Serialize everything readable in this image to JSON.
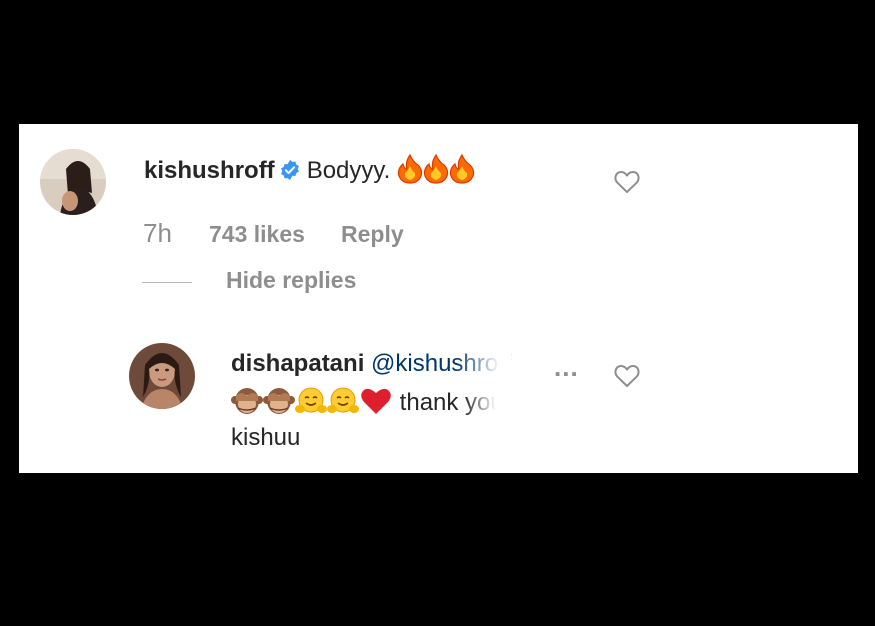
{
  "comment": {
    "username": "kishushroff",
    "text": "Bodyyy.",
    "emoji": [
      "fire-emoji",
      "fire-emoji",
      "fire-emoji"
    ],
    "time": "7h",
    "likes": "743 likes",
    "reply_label": "Reply",
    "hide_replies_label": "Hide replies"
  },
  "reply": {
    "username": "dishapatani",
    "mention": "@kishushroff",
    "more_label": "...",
    "emoji": [
      "see-no-evil-monkey-emoji",
      "see-no-evil-monkey-emoji",
      "hugging-face-emoji",
      "hugging-face-emoji",
      "red-heart-emoji"
    ],
    "text_line1": "thank you",
    "text_line2": "kishuu"
  },
  "colors": {
    "background": "#000000",
    "card": "#ffffff",
    "text": "#262626",
    "meta": "#8e8e8e",
    "mention": "#00376b",
    "verified": "#3897f0",
    "heart_stroke": "#8e8e8e"
  }
}
